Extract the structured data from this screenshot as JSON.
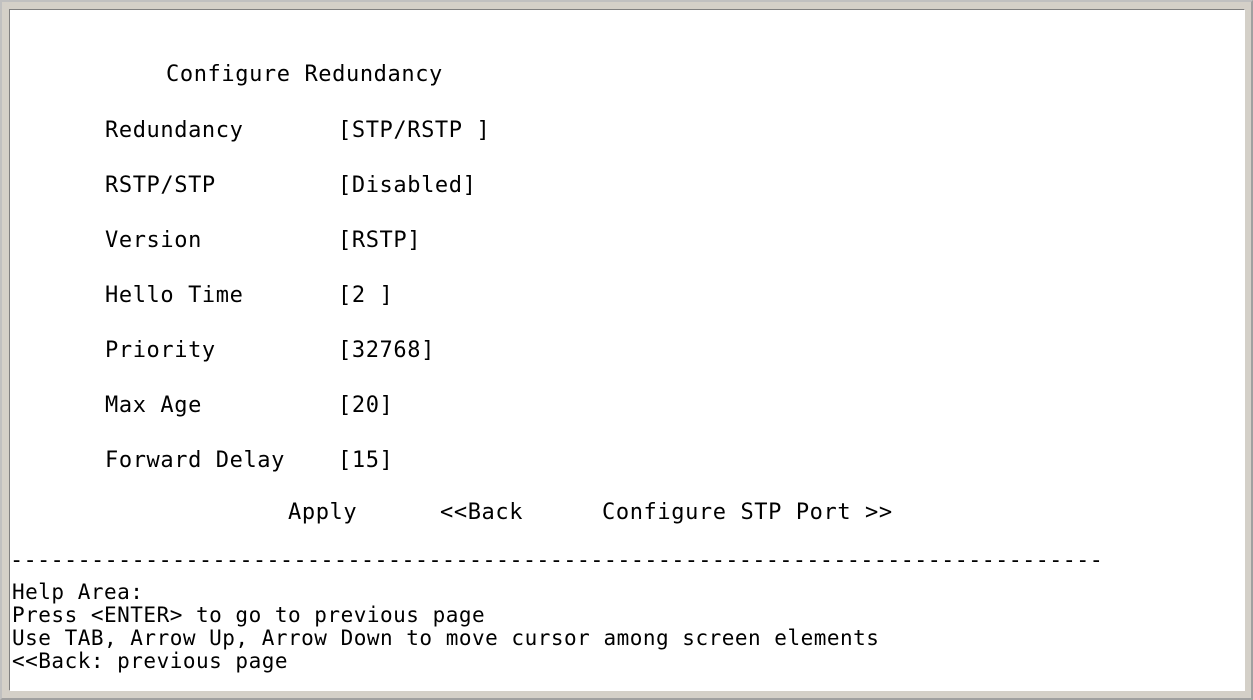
{
  "page": {
    "title": "Configure Redundancy"
  },
  "fields": [
    {
      "label": "Redundancy",
      "value": "[STP/RSTP ]"
    },
    {
      "label": "RSTP/STP",
      "value": "[Disabled]"
    },
    {
      "label": "Version",
      "value": "[RSTP]"
    },
    {
      "label": "Hello Time",
      "value": "[2 ]"
    },
    {
      "label": "Priority",
      "value": "[32768]"
    },
    {
      "label": "Max Age",
      "value": "[20]"
    },
    {
      "label": "Forward Delay",
      "value": "[15]"
    }
  ],
  "actions": {
    "apply": "Apply",
    "back": "<<Back",
    "configure_stp_port": "Configure STP Port >>"
  },
  "divider": "---------------------------------------------------------------------------------",
  "help": {
    "title": "Help Area:",
    "lines": [
      "Press <ENTER> to go to previous page",
      "Use TAB, Arrow Up, Arrow Down to move cursor among screen elements",
      "<<Back: previous page"
    ]
  }
}
